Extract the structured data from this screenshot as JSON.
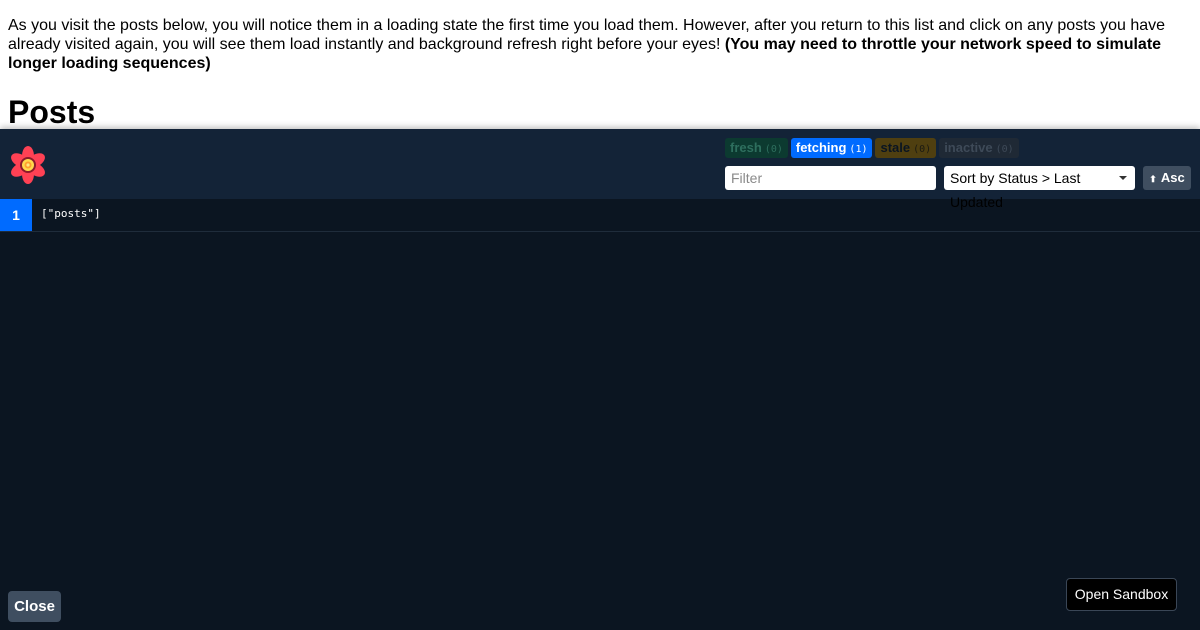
{
  "intro": {
    "text": "As you visit the posts below, you will notice them in a loading state the first time you load them. However, after you return to this list and click on any posts you have already visited again, you will see them load instantly and background refresh right before your eyes! ",
    "bold_text": "(You may need to throttle your network speed to simulate longer loading sequences)"
  },
  "heading": "Posts",
  "devtools": {
    "logo_icon": "react-query-flower-icon",
    "status_badges": [
      {
        "label": "fresh",
        "count": "(0)",
        "color": "#0c3a30"
      },
      {
        "label": "fetching",
        "count": "(1)",
        "color": "#006bff"
      },
      {
        "label": "stale",
        "count": "(0)",
        "color": "#4f3f10"
      },
      {
        "label": "inactive",
        "count": "(0)",
        "color": "#1f2935"
      }
    ],
    "filter": {
      "placeholder": "Filter",
      "value": ""
    },
    "sort": {
      "selected": "Sort by Status > Last Updated"
    },
    "sort_direction": {
      "arrow": "⬆",
      "label": "Asc"
    },
    "queries": [
      {
        "observers": "1",
        "key": "[\"posts\"]"
      }
    ],
    "close_label": "Close",
    "sandbox_label": "Open Sandbox",
    "colors": {
      "panel_bg": "#0b1521",
      "header_bg": "#132337",
      "accent": "#006bff"
    }
  }
}
